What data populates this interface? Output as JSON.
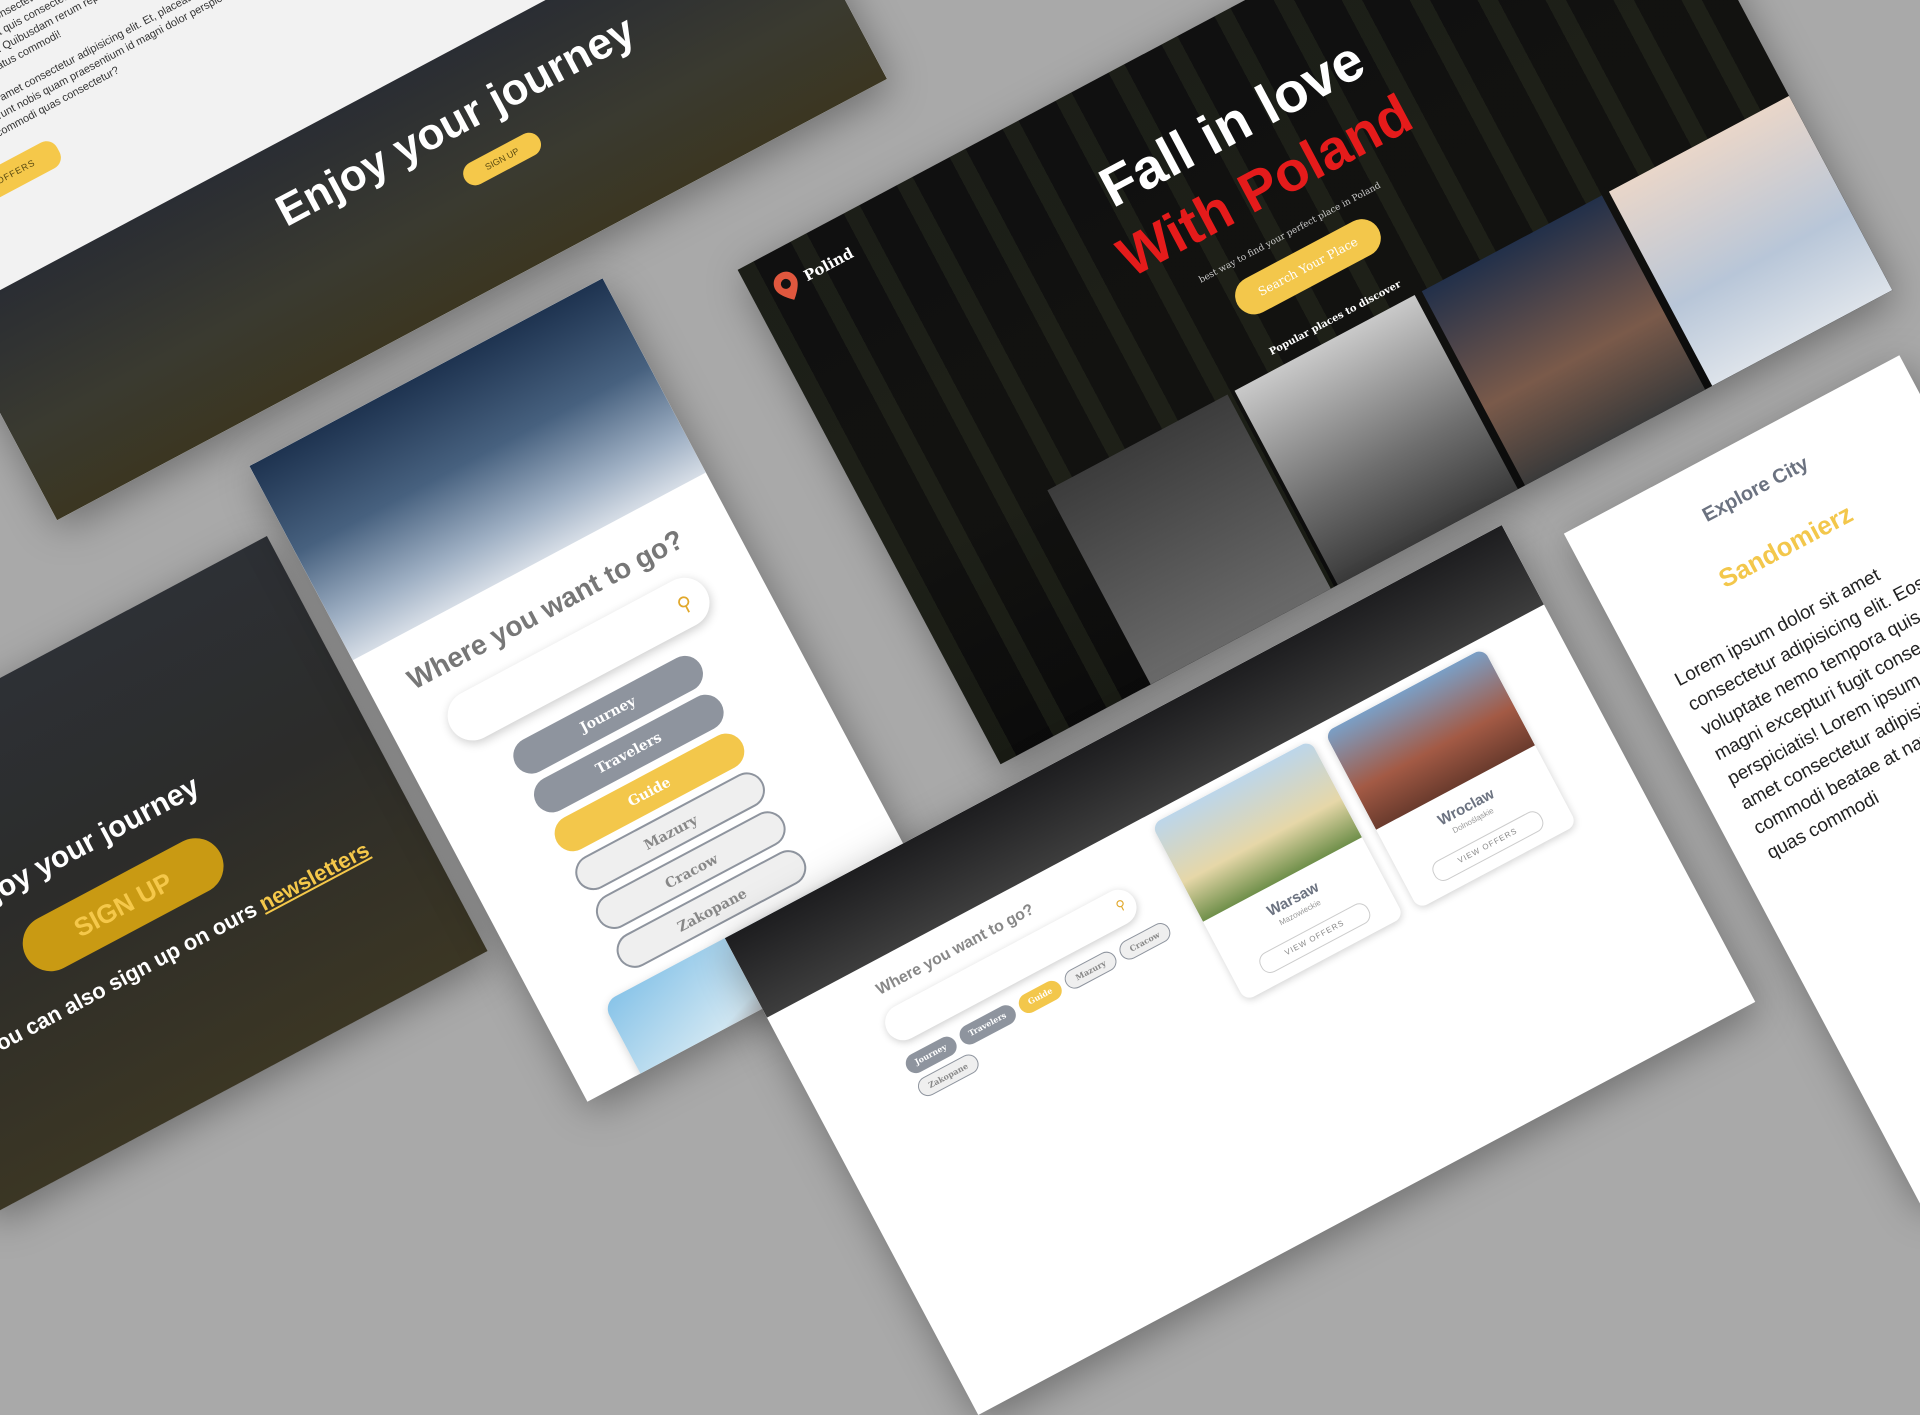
{
  "landing": {
    "paragraph_1": "Lorem ipsum dolor sit amet consectetur adipisicing elit. Eos porro voluptate nemo tempora quis veniam magni excepturi fugit quis consectetur rem perspiciatis! Lorem ipsum dolor sit amet consectetur adipisicing elit. Quibusdam rerum repellendus voluptatem ipsum dolor sit amet accusantium beatae at natus commodi!",
    "paragraph_2": "Lorem ipsum dolor sit amet consectetur adipisicing elit. Et, placeat qui quam esse inventore, unde blanditiis deserunt nobis quam praesentium id magni dolor perspiciatis, dolorem? Similique deleniti nisi quam commodi quas consectetur?",
    "check_offers": "CHECK OFFERS",
    "hero_title": "Enjoy your journey",
    "hero_button": "SIGN UP"
  },
  "signup": {
    "title": "Enjoy your journey",
    "button": "SIGN UP",
    "note": "You can also sign up on ours",
    "note_link": "newsletters"
  },
  "mobile": {
    "question": "Where you want to go?",
    "search_icon": "search-icon",
    "pills": [
      "Journey",
      "Travelers",
      "Guide",
      "Mazury",
      "Cracow",
      "Zakopane"
    ]
  },
  "poland": {
    "brand": "Polind",
    "hero_line_1": "Fall in love",
    "hero_line_2": "With Poland",
    "subtitle": "best way to find your perfect place in Poland",
    "cta": "Search Your Place",
    "popular_heading": "Popular places to discover"
  },
  "desktop": {
    "question": "Where you want to go?",
    "chips": [
      "Journey",
      "Travelers",
      "Guide",
      "Mazury",
      "Cracow",
      "Zakopane"
    ],
    "cards": [
      {
        "name": "Warsaw",
        "region": "Mazowieckie",
        "offers": "VIEW OFFERS"
      },
      {
        "name": "Wroclaw",
        "region": "Dolnośląskie",
        "offers": "VIEW OFFERS"
      }
    ]
  },
  "explore": {
    "heading": "Explore City",
    "city": "Sandomierz",
    "body": "Lorem ipsum dolor sit amet consectetur adipisicing elit. Eos porro voluptate nemo tempora quis veniam magni excepturi fugit consectetur rem perspiciatis! Lorem ipsum dolor sit amet consectetur adipisicing tenetur commodi beatae at natus Nisi sunt quas commodi"
  },
  "colors": {
    "accent_gold": "#f3c74b",
    "accent_red": "#e51b1b",
    "neutral_gray": "#8e949e"
  }
}
